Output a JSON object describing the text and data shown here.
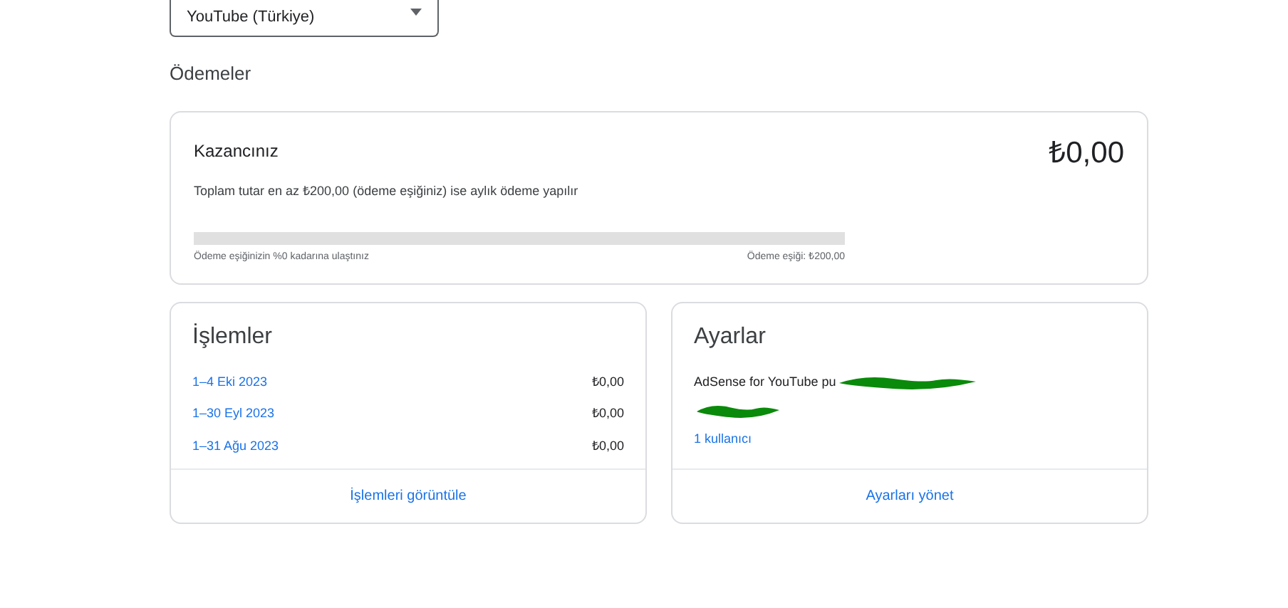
{
  "account_select": {
    "value": "YouTube (Türkiye)"
  },
  "section_title": "Ödemeler",
  "earnings": {
    "title": "Kazancınız",
    "amount": "₺0,00",
    "description": "Toplam tutar en az ₺200,00 (ödeme eşiğiniz) ise aylık ödeme yapılır",
    "level": 0,
    "progress_text": "Ödeme eşiğinizin %0 kadarına ulaştınız",
    "threshold_text": "Ödeme eşiği: ₺200,00"
  },
  "transactions": {
    "title": "İşlemler",
    "rows": [
      {
        "period": "1–4 Eki 2023",
        "amount": "₺0,00"
      },
      {
        "period": "1–30 Eyl 2023",
        "amount": "₺0,00"
      },
      {
        "period": "1–31 Ağu 2023",
        "amount": "₺0,00"
      }
    ],
    "action": "İşlemleri görüntüle"
  },
  "settings": {
    "title": "Ayarlar",
    "publisher_line": "AdSense for YouTube pu",
    "users_link": "1 kullanıcı",
    "action": "Ayarları yönet"
  }
}
